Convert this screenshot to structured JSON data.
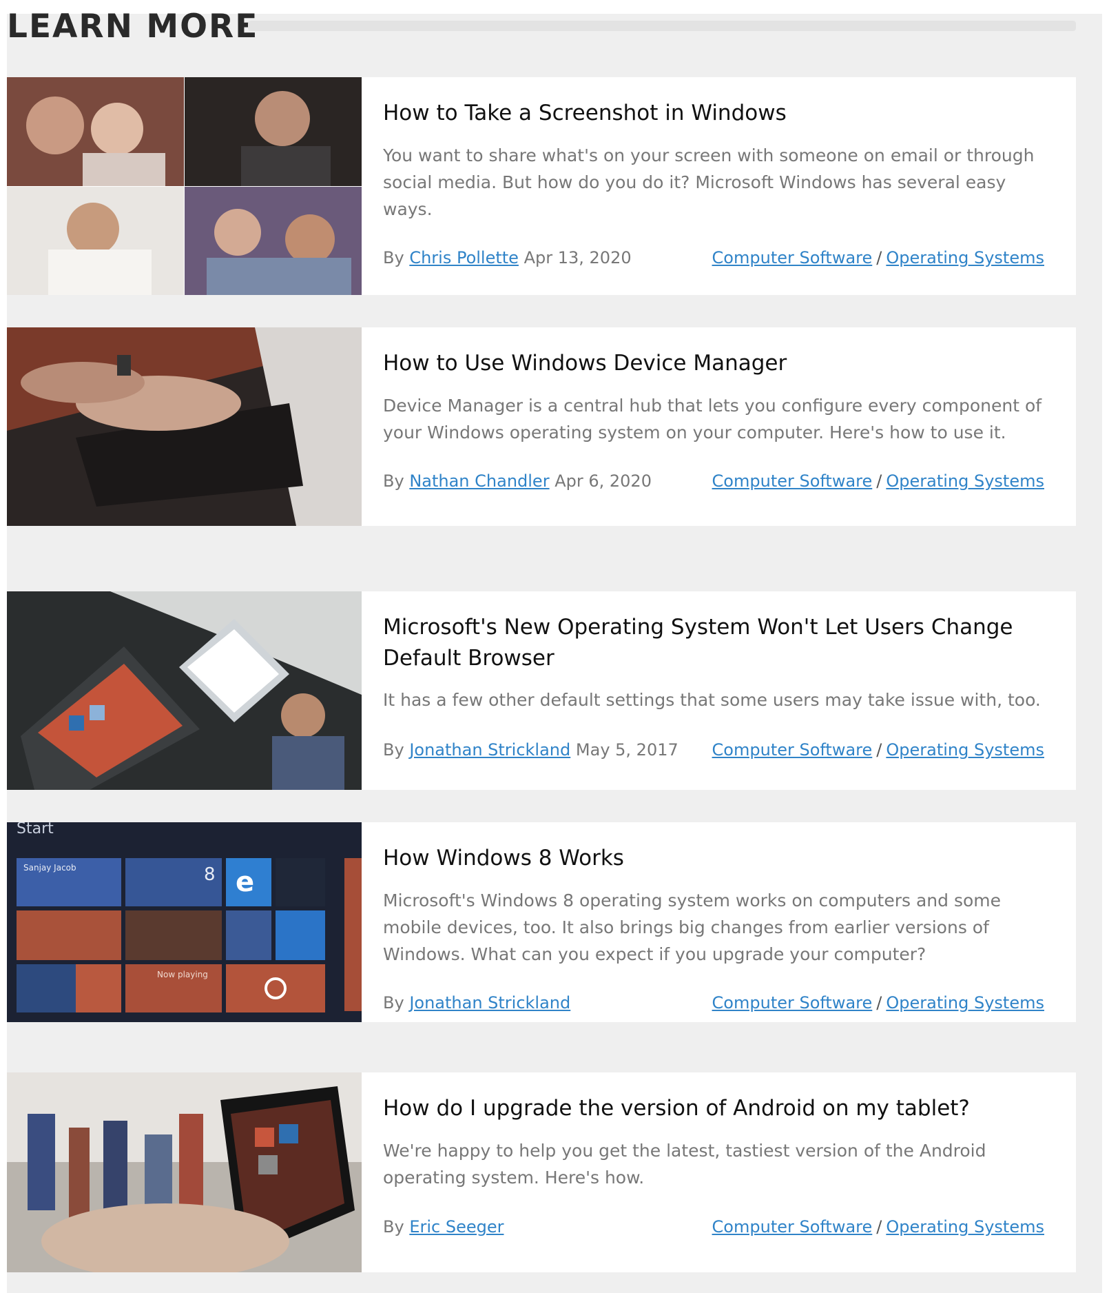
{
  "section": {
    "title": "LEARN MORE"
  },
  "articles": [
    {
      "title": "How to Take a Screenshot in Windows",
      "description": "You want to share what's on your screen with someone on email or through social media. But how do you do it? Microsoft Windows has several easy ways.",
      "by": "By",
      "author": "Chris Pollette",
      "date": "Apr 13, 2020",
      "category1": "Computer Software",
      "category_sep": "/",
      "category2": "Operating Systems"
    },
    {
      "title": "How to Use Windows Device Manager",
      "description": "Device Manager is a central hub that lets you configure every component of your Windows operating system on your computer. Here's how to use it.",
      "by": "By",
      "author": "Nathan Chandler",
      "date": "Apr 6, 2020",
      "category1": "Computer Software",
      "category_sep": "/",
      "category2": "Operating Systems"
    },
    {
      "title": "Microsoft's New Operating System Won't Let Users Change Default Browser",
      "description": "It has a few other default settings that some users may take issue with, too.",
      "by": "By",
      "author": "Jonathan Strickland",
      "date": "May 5, 2017",
      "category1": "Computer Software",
      "category_sep": "/",
      "category2": "Operating Systems"
    },
    {
      "title": "How Windows 8 Works",
      "description": "Microsoft's Windows 8 operating system works on computers and some mobile devices, too. It also brings big changes from earlier versions of Windows. What can you expect if you upgrade your computer?",
      "by": "By",
      "author": "Jonathan Strickland",
      "date": "",
      "category1": "Computer Software",
      "category_sep": "/",
      "category2": "Operating Systems",
      "thumb_text": {
        "start": "Start",
        "tile_name": "Sanjay Jacob",
        "tile_num": "8",
        "now_playing": "Now playing"
      }
    },
    {
      "title": "How do I upgrade the version of Android on my tablet?",
      "description": "We're happy to help you get the latest, tastiest version of the Android operating system. Here's how.",
      "by": "By",
      "author": "Eric Seeger",
      "date": "",
      "category1": "Computer Software",
      "category_sep": "/",
      "category2": "Operating Systems"
    }
  ]
}
